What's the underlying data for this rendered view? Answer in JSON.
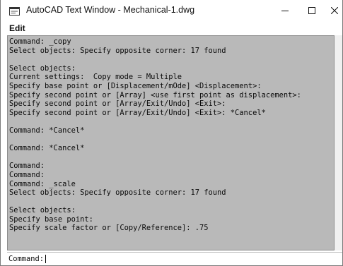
{
  "window": {
    "title": "AutoCAD Text Window - Mechanical-1.dwg",
    "icon": "autocad-text-window-icon",
    "controls": [
      "minimize",
      "maximize",
      "close"
    ]
  },
  "menu": {
    "items": [
      {
        "label": "Edit"
      }
    ]
  },
  "history": {
    "lines": [
      "Command: _copy",
      "Select objects: Specify opposite corner: 17 found",
      "",
      "Select objects:",
      "Current settings:  Copy mode = Multiple",
      "Specify base point or [Displacement/mOde] <Displacement>:",
      "Specify second point or [Array] <use first point as displacement>:",
      "Specify second point or [Array/Exit/Undo] <Exit>:",
      "Specify second point or [Array/Exit/Undo] <Exit>: *Cancel*",
      "",
      "Command: *Cancel*",
      "",
      "Command: *Cancel*",
      "",
      "Command:",
      "Command:",
      "Command: _scale",
      "Select objects: Specify opposite corner: 17 found",
      "",
      "Select objects:",
      "Specify base point:",
      "Specify scale factor or [Copy/Reference]: .75"
    ]
  },
  "command_line": {
    "prompt": "Command:",
    "value": ""
  },
  "colors": {
    "history_background": "#b9b9b9",
    "window_background": "#ffffff"
  }
}
